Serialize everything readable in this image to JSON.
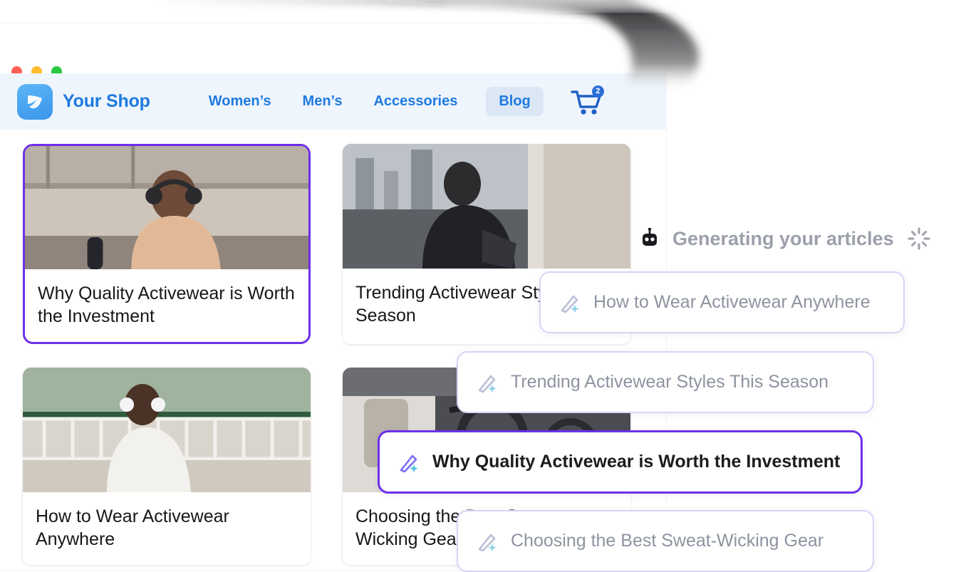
{
  "window": {
    "traffic_lights": [
      "close",
      "minimize",
      "zoom"
    ]
  },
  "site": {
    "brand_name": "Your Shop",
    "nav_links": [
      {
        "label": "Women’s",
        "active": false
      },
      {
        "label": "Men’s",
        "active": false
      },
      {
        "label": "Accessories",
        "active": false
      },
      {
        "label": "Blog",
        "active": true
      }
    ],
    "cart": {
      "icon": "shopping-cart-icon",
      "badge": "2"
    }
  },
  "articles": [
    {
      "title": "Why Quality Activewear is Worth the Investment",
      "selected": true
    },
    {
      "title": "Trending Activewear Styles This Season",
      "selected": false
    },
    {
      "title": "How to Wear Activewear Anywhere",
      "selected": false
    },
    {
      "title": "Choosing the Best Sweat-Wicking Gear",
      "selected": false
    }
  ],
  "generating": {
    "label": "Generating your articles",
    "bot_icon": "robot-icon",
    "loader_icon": "spinner-icon"
  },
  "suggestions": [
    {
      "label": "How to Wear Activewear Anywhere",
      "icon": "magic-wand-icon",
      "highlighted": false
    },
    {
      "label": "Trending Activewear Styles This Season",
      "icon": "magic-wand-icon",
      "highlighted": false
    },
    {
      "label": "Why Quality Activewear is Worth the Investment",
      "icon": "magic-wand-icon",
      "highlighted": true
    },
    {
      "label": "Choosing the Best Sweat-Wicking Gear",
      "icon": "magic-wand-icon",
      "highlighted": false
    }
  ],
  "colors": {
    "accent_purple": "#6d30e8",
    "brand_blue": "#1f7ae0",
    "nav_bg": "#eef5fc",
    "chip_border": "#d9d3f5",
    "muted_text": "#8d93a0"
  }
}
